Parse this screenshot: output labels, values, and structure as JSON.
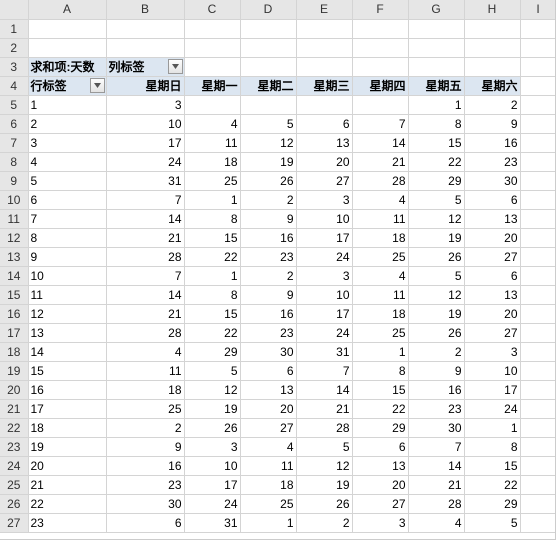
{
  "columns": [
    "A",
    "B",
    "C",
    "D",
    "E",
    "F",
    "G",
    "H",
    "I"
  ],
  "pivot": {
    "measure_label": "求和项:天数",
    "col_field_label": "列标签",
    "row_field_label": "行标签",
    "col_headers": [
      "星期日",
      "星期一",
      "星期二",
      "星期三",
      "星期四",
      "星期五",
      "星期六"
    ]
  },
  "chart_data": {
    "type": "table",
    "title": "求和项:天数",
    "xlabel": "列标签",
    "ylabel": "行标签",
    "categories": [
      "星期日",
      "星期一",
      "星期二",
      "星期三",
      "星期四",
      "星期五",
      "星期六"
    ],
    "row_labels": [
      "1",
      "2",
      "3",
      "4",
      "5",
      "6",
      "7",
      "8",
      "9",
      "10",
      "11",
      "12",
      "13",
      "14",
      "15",
      "16",
      "17",
      "18",
      "19",
      "20",
      "21",
      "22",
      "23"
    ],
    "values": [
      [
        3,
        null,
        null,
        null,
        null,
        1,
        2
      ],
      [
        10,
        4,
        5,
        6,
        7,
        8,
        9
      ],
      [
        17,
        11,
        12,
        13,
        14,
        15,
        16
      ],
      [
        24,
        18,
        19,
        20,
        21,
        22,
        23
      ],
      [
        31,
        25,
        26,
        27,
        28,
        29,
        30
      ],
      [
        7,
        1,
        2,
        3,
        4,
        5,
        6
      ],
      [
        14,
        8,
        9,
        10,
        11,
        12,
        13
      ],
      [
        21,
        15,
        16,
        17,
        18,
        19,
        20
      ],
      [
        28,
        22,
        23,
        24,
        25,
        26,
        27
      ],
      [
        7,
        1,
        2,
        3,
        4,
        5,
        6
      ],
      [
        14,
        8,
        9,
        10,
        11,
        12,
        13
      ],
      [
        21,
        15,
        16,
        17,
        18,
        19,
        20
      ],
      [
        28,
        22,
        23,
        24,
        25,
        26,
        27
      ],
      [
        4,
        29,
        30,
        31,
        1,
        2,
        3
      ],
      [
        11,
        5,
        6,
        7,
        8,
        9,
        10
      ],
      [
        18,
        12,
        13,
        14,
        15,
        16,
        17
      ],
      [
        25,
        19,
        20,
        21,
        22,
        23,
        24
      ],
      [
        2,
        26,
        27,
        28,
        29,
        30,
        1
      ],
      [
        9,
        3,
        4,
        5,
        6,
        7,
        8
      ],
      [
        16,
        10,
        11,
        12,
        13,
        14,
        15
      ],
      [
        23,
        17,
        18,
        19,
        20,
        21,
        22
      ],
      [
        30,
        24,
        25,
        26,
        27,
        28,
        29
      ],
      [
        6,
        31,
        1,
        2,
        3,
        4,
        5
      ]
    ]
  }
}
